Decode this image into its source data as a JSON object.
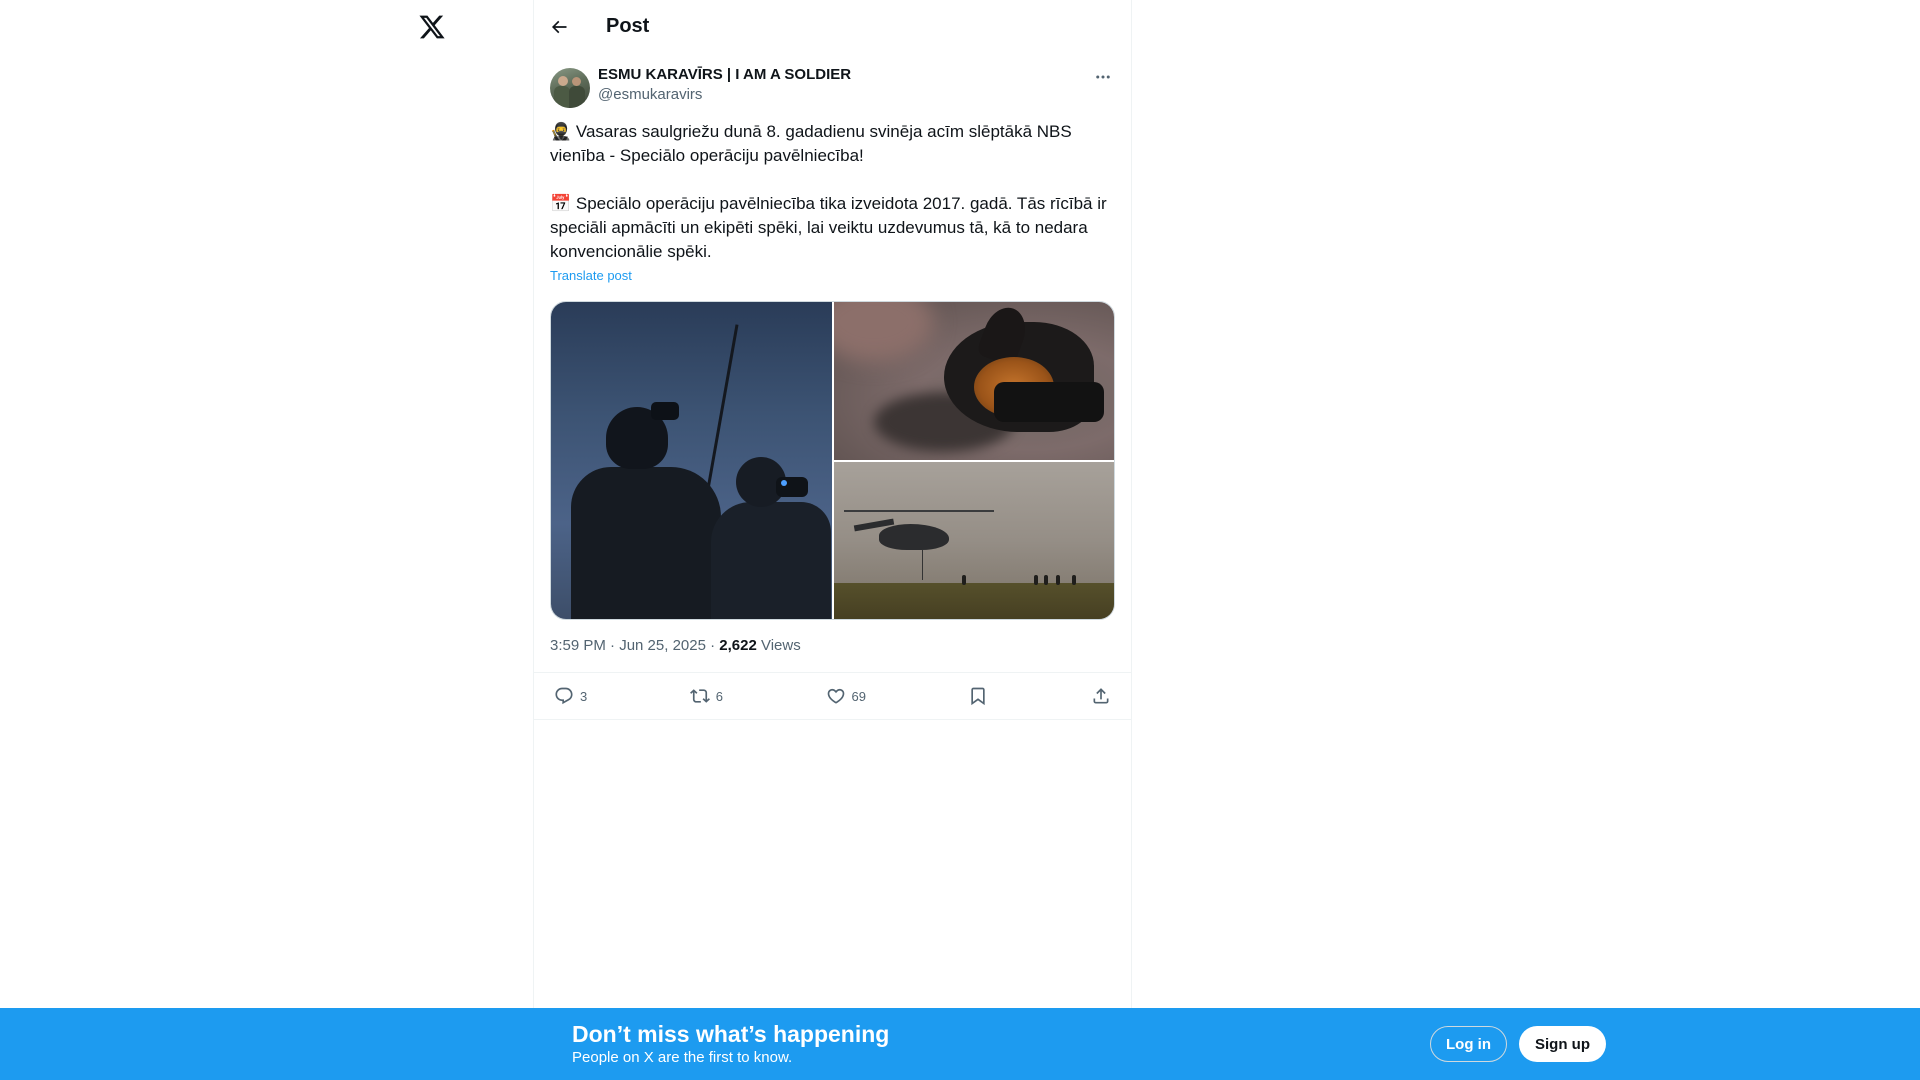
{
  "app": {
    "logo_icon": "x-logo-icon"
  },
  "header": {
    "title": "Post",
    "back_icon": "arrow-left-icon"
  },
  "post": {
    "author": {
      "name": "ESMU KARAVĪRS | I AM A SOLDIER",
      "handle": "@esmukaravirs"
    },
    "text": "🥷 Vasaras saulgriežu dunā 8. gadadienu svinēja acīm slēptākā NBS vienība - Speciālo operāciju pavēlniecība!\n\n📅 Speciālo operāciju pavēlniecība tika izveidota 2017. gadā. Tās rīcībā ir speciāli apmācīti un ekipēti spēki, lai veiktu uzdevumus tā, kā to nedara konvencionālie spēki.",
    "translate_label": "Translate post",
    "time": "3:59 PM · Jun 25, 2025 · ",
    "views_count": "2,622",
    "views_label": " Views",
    "actions": {
      "replies": "3",
      "reposts": "6",
      "likes": "69"
    }
  },
  "banner": {
    "title": "Don’t miss what’s happening",
    "subtitle": "People on X are the first to know.",
    "login_label": "Log in",
    "signup_label": "Sign up",
    "background_color": "#1d9bf0"
  }
}
